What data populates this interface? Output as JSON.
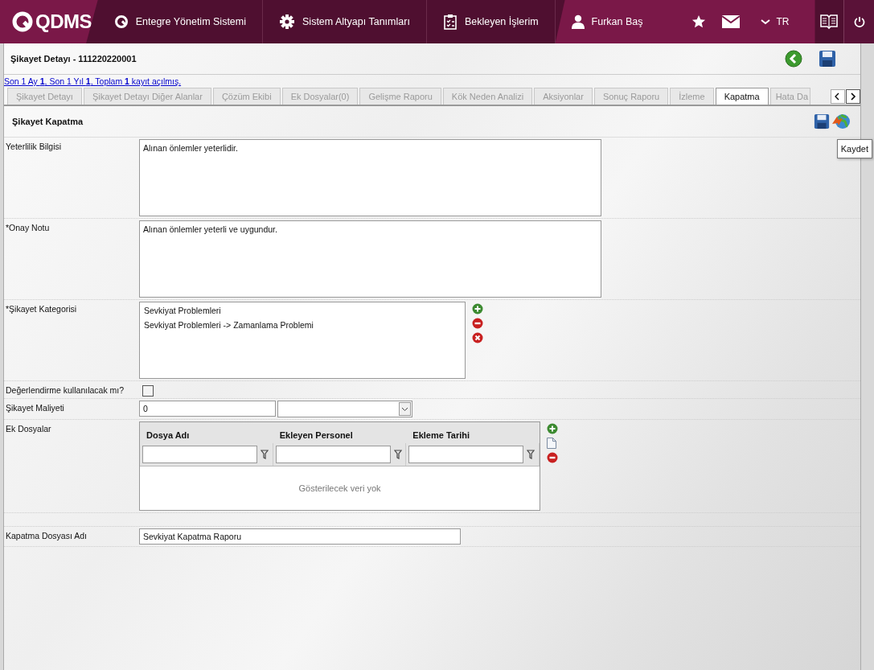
{
  "nav": {
    "logo": "QDMS",
    "items": [
      {
        "kind": "q",
        "label": "Entegre Yönetim Sistemi"
      },
      {
        "kind": "gear",
        "label": "Sistem Altyapı Tanımları"
      },
      {
        "kind": "clipboard",
        "label": "Bekleyen İşlerim"
      }
    ],
    "user": "Furkan Baş",
    "language": "TR"
  },
  "record": {
    "title": "Şikayet Detayı - 111220220001",
    "summary": "Son 1 Ay **1**, Son 1 Yıl **1**, Toplam **1** kayıt açılmış."
  },
  "tabs": [
    {
      "label": "Şikayet Detayı",
      "selected": false
    },
    {
      "label": "Şikayet Detayı Diğer Alanlar",
      "selected": false
    },
    {
      "label": "Çözüm Ekibi",
      "selected": false
    },
    {
      "label": "Ek Dosyalar(0)",
      "selected": false
    },
    {
      "label": "Gelişme Raporu",
      "selected": false
    },
    {
      "label": "Kök Neden Analizi",
      "selected": false
    },
    {
      "label": "Aksiyonlar",
      "selected": false
    },
    {
      "label": "Sonuç Raporu",
      "selected": false
    },
    {
      "label": "İzleme",
      "selected": false
    },
    {
      "label": "Kapatma",
      "selected": true
    },
    {
      "label": "Hata Da",
      "selected": false
    }
  ],
  "section": {
    "title": "Şikayet Kapatma",
    "tooltip": "Kaydet"
  },
  "form": [
    {
      "kind": "textarea",
      "label": "Yeterlilik Bilgisi",
      "value": "Alınan önlemler yeterlidir."
    },
    {
      "kind": "textarea",
      "label": "*Onay Notu",
      "value": "Alınan önlemler yeterli ve uygundur."
    },
    {
      "kind": "list",
      "label": "*Şikayet Kategorisi",
      "items": [
        "Sevkiyat Problemleri",
        "Sevkiyat Problemleri -> Zamanlama Problemi"
      ]
    },
    {
      "kind": "checkbox",
      "label": "Değerlendirme kullanılacak mı?",
      "checked": false
    },
    {
      "kind": "amount",
      "label": "Şikayet Maliyeti",
      "value": "0"
    },
    {
      "kind": "grid",
      "label": "Ek Dosyalar",
      "columns": [
        "Dosya Adı",
        "Ekleyen Personel",
        "Ekleme Tarihi"
      ],
      "empty_text": "Gösterilecek veri yok"
    },
    {
      "kind": "text",
      "label": "Kapatma Dosyası Adı",
      "value": "Sevkiyat Kapatma Raporu"
    }
  ]
}
